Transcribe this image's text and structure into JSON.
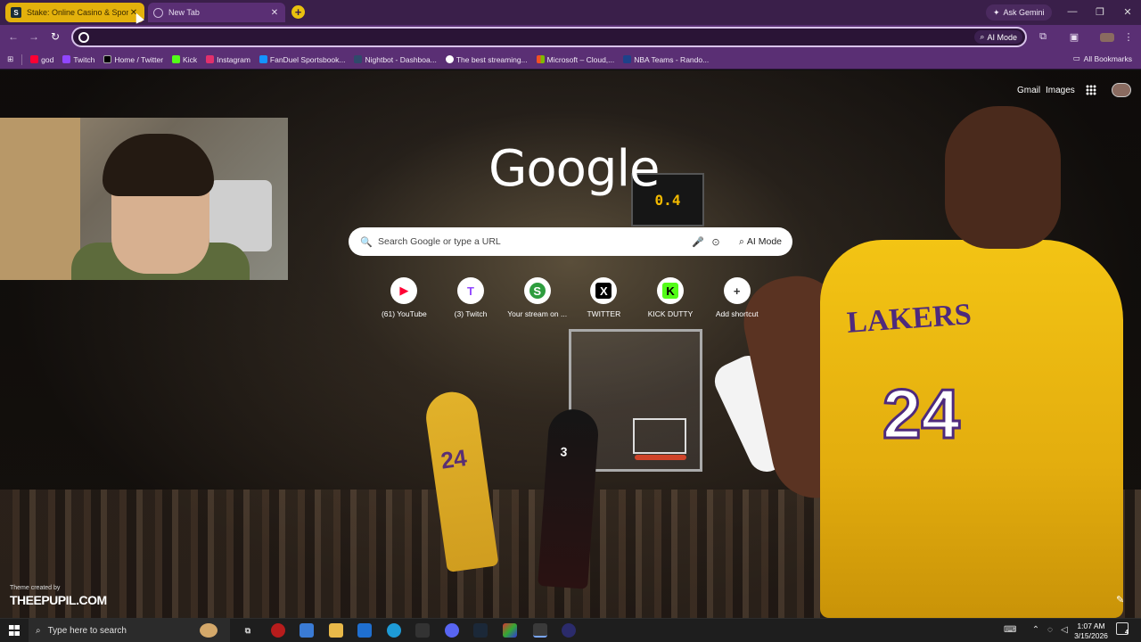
{
  "browser": {
    "tabs": [
      {
        "title": "Stake: Online Casino & Sports",
        "favicon": "S",
        "active": false
      },
      {
        "title": "New Tab",
        "active": true
      }
    ],
    "ask_gemini": "Ask Gemini",
    "omnibox": {
      "value": "",
      "ai_mode": "AI Mode"
    },
    "bookmarks": [
      {
        "label": "god",
        "icon_color": "#ff0033"
      },
      {
        "label": "Twitch",
        "icon_color": "#9146ff"
      },
      {
        "label": "Home / Twitter",
        "icon_color": "#000000"
      },
      {
        "label": "Kick",
        "icon_color": "#53fc18"
      },
      {
        "label": "Instagram",
        "icon_color": "#e1306c"
      },
      {
        "label": "FanDuel Sportsbook...",
        "icon_color": "#1493ff"
      },
      {
        "label": "Nightbot - Dashboa...",
        "icon_color": "#2f4a6b"
      },
      {
        "label": "The best streaming...",
        "icon_color": "#ffffff"
      },
      {
        "label": "Microsoft – Cloud,...",
        "icon_color": "#f25022"
      },
      {
        "label": "NBA Teams - Rando...",
        "icon_color": "#1d428a"
      }
    ],
    "all_bookmarks": "All Bookmarks"
  },
  "webcam": {
    "scene": "webcam-overlay"
  },
  "ntp": {
    "gmail": "Gmail",
    "images": "Images",
    "logo": "Google",
    "scoreboard": "0.4",
    "search_placeholder": "Search Google or type a URL",
    "ai_mode": "AI Mode",
    "shortcuts": [
      {
        "label": "(61) YouTube",
        "icon": "youtube-icon",
        "glyph": "▶",
        "color": "#ff0033",
        "bg": "#ffffff"
      },
      {
        "label": "(3) Twitch",
        "icon": "twitch-icon",
        "glyph": "T",
        "color": "#9146ff",
        "bg": "#ffffff"
      },
      {
        "label": "Your stream on ...",
        "icon": "stream-icon",
        "glyph": "S",
        "color": "#ffffff",
        "bg": "#2e9d3e"
      },
      {
        "label": "TWITTER",
        "icon": "x-icon",
        "glyph": "X",
        "color": "#000000",
        "bg": "#ffffff"
      },
      {
        "label": "KICK DUTTY",
        "icon": "kick-icon",
        "glyph": "K",
        "color": "#000000",
        "bg": "#53fc18"
      },
      {
        "label": "Add shortcut",
        "icon": "plus-icon",
        "glyph": "+",
        "color": "#333333",
        "bg": "#ffffff"
      }
    ],
    "theme_credit": "Theme created by",
    "theme_brand": "THEEPUPIL.COM",
    "hero_text": "LAKERS",
    "hero_number": "24",
    "player_number": "24",
    "heat_number": "3"
  },
  "taskbar": {
    "search_placeholder": "Type here to search",
    "time": "1:07 AM",
    "date": "3/15/2026",
    "notifications": "4"
  }
}
